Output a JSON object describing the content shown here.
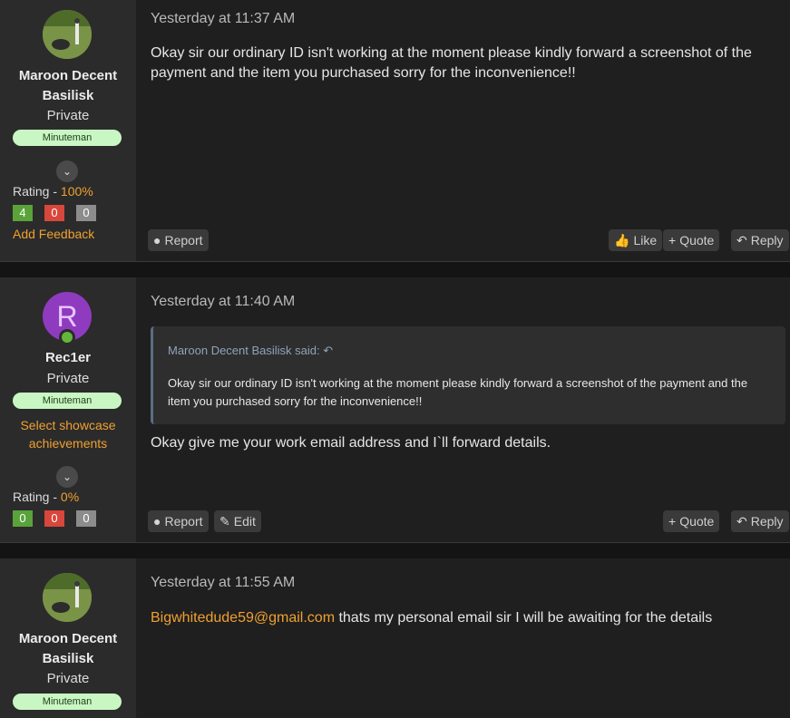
{
  "posts": [
    {
      "author": {
        "name": "Maroon Decent Basilisk",
        "title": "Private",
        "banner": "Minuteman",
        "avatar_icon": "photo-avatar-icon"
      },
      "rating": {
        "label": "Rating - ",
        "percent": "100%",
        "positive": "4",
        "negative": "0",
        "neutral": "0"
      },
      "add_feedback": "Add Feedback",
      "timestamp": "Yesterday at 11:37 AM",
      "message": "Okay sir our ordinary ID isn't working at the moment please kindly forward a screenshot of the payment and the item you purchased sorry for the inconvenience!!",
      "actions": {
        "report": "Report",
        "like": "Like",
        "quote": "Quote",
        "reply": "Reply"
      }
    },
    {
      "author": {
        "name": "Rec1er",
        "title": "Private",
        "banner": "Minuteman",
        "avatar_letter": "R"
      },
      "showcase": "Select showcase achievements",
      "rating": {
        "label": "Rating - ",
        "percent": "0%",
        "positive": "0",
        "negative": "0",
        "neutral": "0"
      },
      "timestamp": "Yesterday at 11:40 AM",
      "quote": {
        "attribution": "Maroon Decent Basilisk said:",
        "text": "Okay sir our ordinary ID isn't working at the moment please kindly forward a screenshot of the payment and the item you purchased sorry for the inconvenience!!"
      },
      "message": "Okay give me your work email address and I`ll forward details.",
      "actions": {
        "report": "Report",
        "edit": "Edit",
        "quote": "Quote",
        "reply": "Reply"
      }
    },
    {
      "author": {
        "name": "Maroon Decent Basilisk",
        "title": "Private",
        "banner": "Minuteman",
        "avatar_icon": "photo-avatar-icon"
      },
      "timestamp": "Yesterday at 11:55 AM",
      "email_link": "Bigwhitedude59@gmail.com",
      "message": " thats my personal email sir I will be awaiting for the details"
    }
  ],
  "colors": {
    "accent": "#f0a030",
    "banner_bg": "#c9f7c3",
    "positive": "#5aa33a",
    "negative": "#d9463b",
    "neutral": "#8c8c8c"
  }
}
